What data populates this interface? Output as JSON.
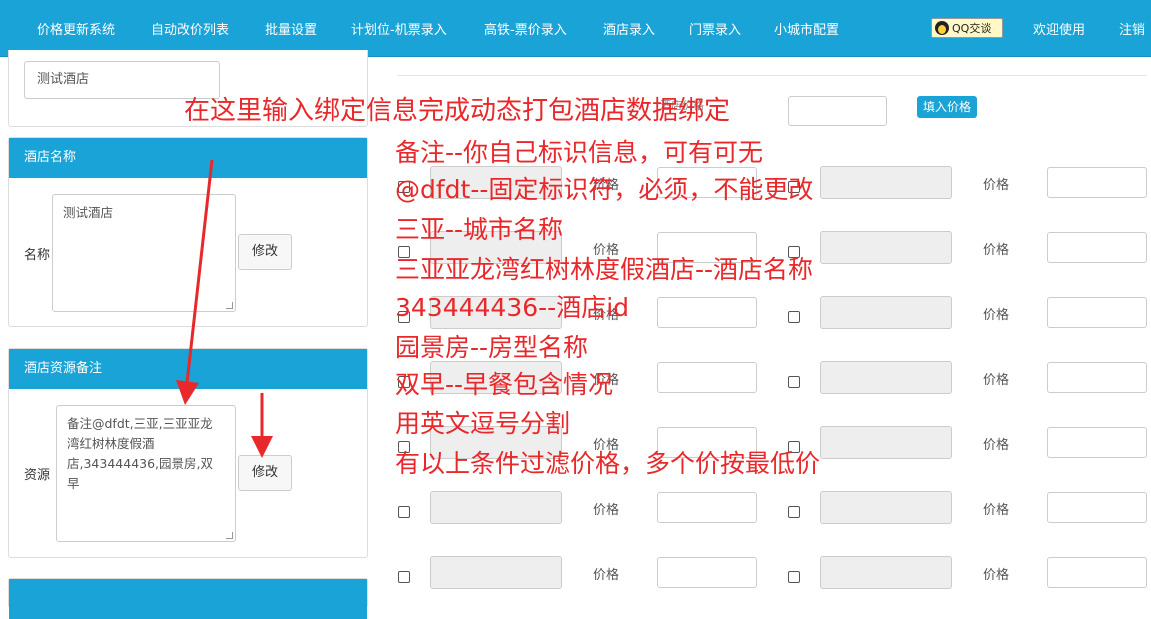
{
  "nav": {
    "items": [
      "价格更新系统",
      "自动改价列表",
      "批量设置",
      "计划位-机票录入",
      "高铁-票价录入",
      "酒店录入",
      "门票录入",
      "小城市配置"
    ],
    "qq_label": "QQ交谈",
    "welcome": "欢迎使用",
    "logout": "注销"
  },
  "left": {
    "top_input_value": "测试酒店",
    "hotel_name_panel": {
      "title": "酒店名称",
      "field_label": "名称",
      "value": "测试酒店",
      "button": "修改"
    },
    "resource_panel": {
      "title": "酒店资源备注",
      "field_label": "资源",
      "value": "备注@dfdt,三亚,三亚亚龙湾红树林度假酒店,343444436,园景房,双早",
      "button": "修改"
    }
  },
  "right": {
    "top_field_label": "酒店价格",
    "fill_button": "填入价格",
    "price_label": "价格",
    "row_count": 7
  },
  "annotation": {
    "headline": "在这里输入绑定信息完成动态打包酒店数据绑定",
    "lines": [
      "备注--你自己标识信息，可有可无",
      "@dfdt--固定标识符，必须，不能更改",
      "三亚--城市名称",
      "三亚亚龙湾红树林度假酒店--酒店名称",
      "343444436--酒店id",
      "园景房--房型名称",
      "双早--早餐包含情况",
      "用英文逗号分割",
      "有以上条件过滤价格，多个价按最低价"
    ]
  },
  "colors": {
    "brand": "#1aa3d6",
    "annotation": "#e8282a"
  }
}
